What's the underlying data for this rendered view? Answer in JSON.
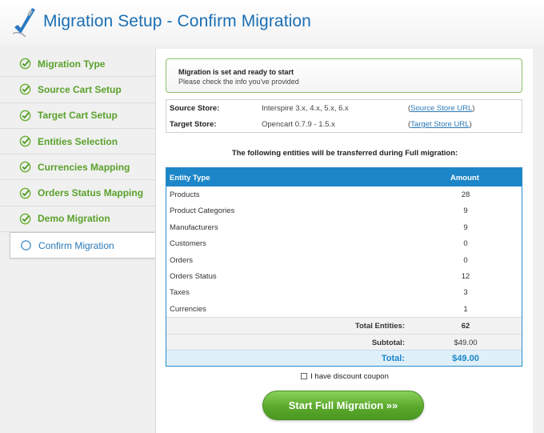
{
  "header": {
    "title": "Migration Setup - Confirm Migration",
    "logo_icon": "pen-check-logo-icon"
  },
  "sidebar": {
    "steps": [
      {
        "label": "Migration Type",
        "status": "done"
      },
      {
        "label": "Source Cart Setup",
        "status": "done"
      },
      {
        "label": "Target Cart Setup",
        "status": "done"
      },
      {
        "label": "Entities Selection",
        "status": "done"
      },
      {
        "label": "Currencies Mapping",
        "status": "done"
      },
      {
        "label": "Orders Status Mapping",
        "status": "done"
      },
      {
        "label": "Demo Migration",
        "status": "done"
      },
      {
        "label": "Confirm Migration",
        "status": "active"
      }
    ]
  },
  "notice": {
    "title": "Migration is set and ready to start",
    "subtitle": "Please check the info you've provided"
  },
  "stores": {
    "source": {
      "label": "Source Store:",
      "value": "Interspire 3.x, 4.x, 5.x, 6.x",
      "link_text": "Source Store URL"
    },
    "target": {
      "label": "Target Store:",
      "value": "Opencart 0.7.9 - 1.5.x",
      "link_text": "Target Store URL"
    }
  },
  "entities": {
    "heading": "The following entities will be transferred during Full migration:",
    "col_type": "Entity Type",
    "col_amount": "Amount",
    "rows": [
      {
        "type": "Products",
        "amount": "28"
      },
      {
        "type": "Product Categories",
        "amount": "9"
      },
      {
        "type": "Manufacturers",
        "amount": "9"
      },
      {
        "type": "Customers",
        "amount": "0"
      },
      {
        "type": "Orders",
        "amount": "0"
      },
      {
        "type": "Orders Status",
        "amount": "12"
      },
      {
        "type": "Taxes",
        "amount": "3"
      },
      {
        "type": "Currencies",
        "amount": "1"
      }
    ],
    "total_entities_label": "Total Entities:",
    "total_entities_value": "62",
    "subtotal_label": "Subtotal:",
    "subtotal_value": "$49.00",
    "total_label": "Total:",
    "total_value": "$49.00"
  },
  "coupon": {
    "label": "I have discount coupon",
    "checked": false
  },
  "start_button": {
    "label": "Start Full Migration »»"
  },
  "colors": {
    "accent_blue": "#1d86c8",
    "success_green": "#5aa12b",
    "title_blue": "#1a6fb5"
  }
}
